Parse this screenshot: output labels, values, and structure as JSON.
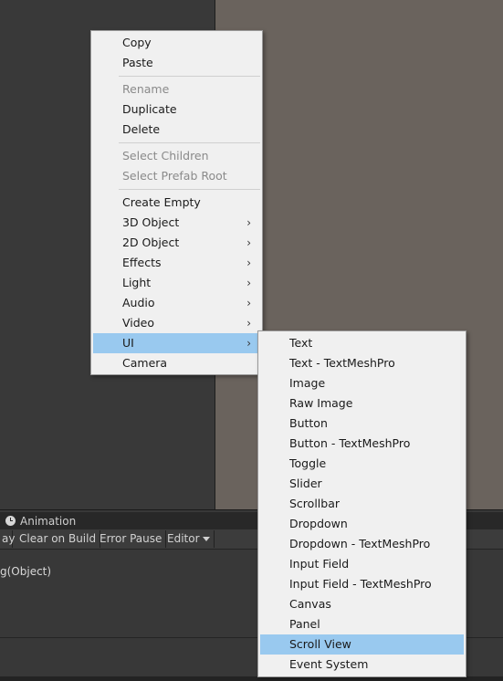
{
  "context_menu": {
    "items": [
      {
        "label": "Copy"
      },
      {
        "label": "Paste"
      },
      {
        "label": "Rename"
      },
      {
        "label": "Duplicate"
      },
      {
        "label": "Delete"
      },
      {
        "label": "Select Children"
      },
      {
        "label": "Select Prefab Root"
      },
      {
        "label": "Create Empty"
      },
      {
        "label": "3D Object"
      },
      {
        "label": "2D Object"
      },
      {
        "label": "Effects"
      },
      {
        "label": "Light"
      },
      {
        "label": "Audio"
      },
      {
        "label": "Video"
      },
      {
        "label": "UI"
      },
      {
        "label": "Camera"
      }
    ],
    "submenu_arrow": "›"
  },
  "ui_submenu": {
    "items": [
      {
        "label": "Text"
      },
      {
        "label": "Text - TextMeshPro"
      },
      {
        "label": "Image"
      },
      {
        "label": "Raw Image"
      },
      {
        "label": "Button"
      },
      {
        "label": "Button - TextMeshPro"
      },
      {
        "label": "Toggle"
      },
      {
        "label": "Slider"
      },
      {
        "label": "Scrollbar"
      },
      {
        "label": "Dropdown"
      },
      {
        "label": "Dropdown - TextMeshPro"
      },
      {
        "label": "Input Field"
      },
      {
        "label": "Input Field - TextMeshPro"
      },
      {
        "label": "Canvas"
      },
      {
        "label": "Panel"
      },
      {
        "label": "Scroll View"
      },
      {
        "label": "Event System"
      }
    ]
  },
  "bottom_panel": {
    "tab_label": "Animation",
    "toolbar": {
      "play_partial": "ay",
      "clear_on_build": "Clear on Build",
      "error_pause": "Error Pause",
      "editor": "Editor"
    },
    "log_line": "g(Object)"
  },
  "colors": {
    "menu_bg": "#f0f0f0",
    "highlight": "#99c9ef",
    "scene_bg": "#6a635d",
    "panel_bg": "#393939"
  }
}
